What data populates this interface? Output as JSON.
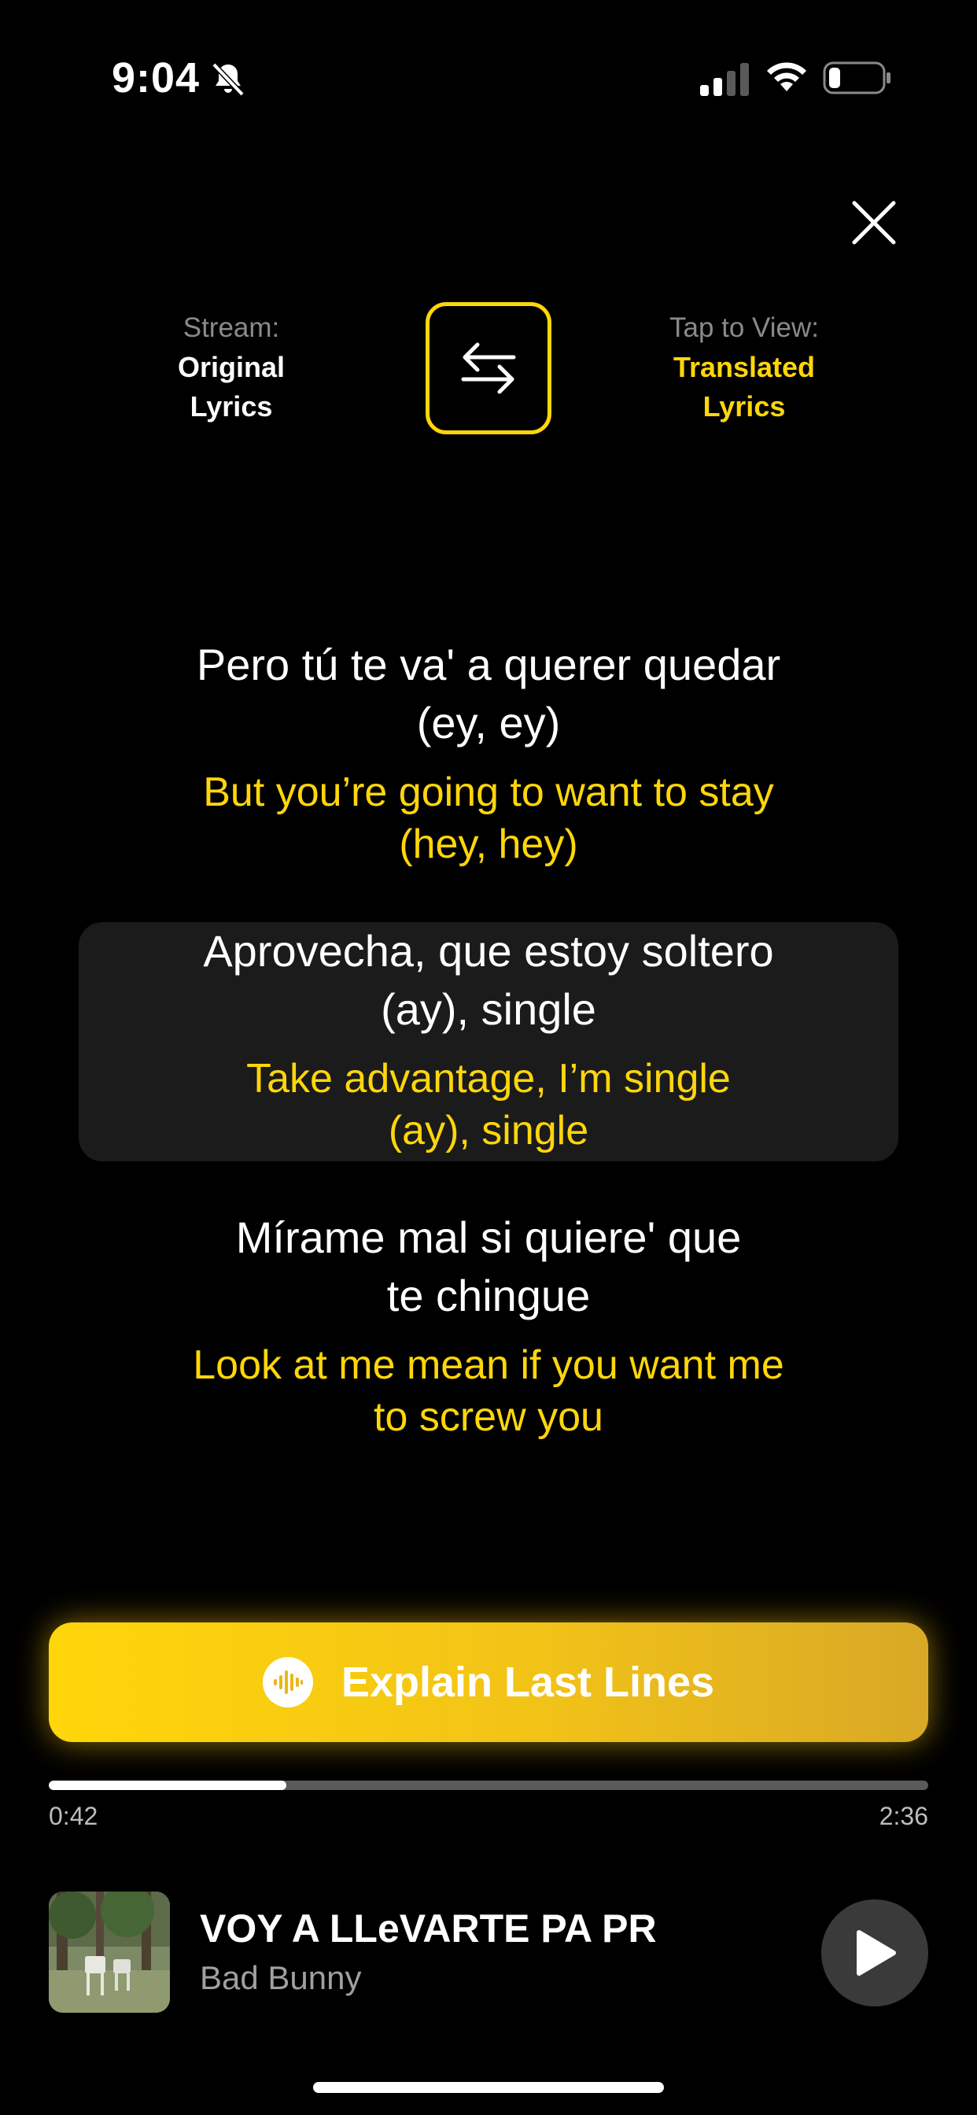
{
  "status_bar": {
    "time": "9:04"
  },
  "toggle": {
    "left_caption": "Stream:",
    "left_line1": "Original",
    "left_line2": "Lyrics",
    "right_caption": "Tap to View:",
    "right_line1": "Translated",
    "right_line2": "Lyrics"
  },
  "lyrics": [
    {
      "orig1": "Pero tú te va' a querer quedar",
      "orig2": "(ey, ey)",
      "trans1": "But you’re going to want to stay",
      "trans2": "(hey, hey)"
    },
    {
      "orig1": "Aprovecha, que estoy soltero",
      "orig2": "(ay), single",
      "trans1": "Take advantage, I’m single",
      "trans2": "(ay), single"
    },
    {
      "orig1": "Mírame mal si quiere' que",
      "orig2": "te chingue",
      "trans1": "Look at me mean if you want me",
      "trans2": "to screw you"
    }
  ],
  "explain_button": {
    "label": "Explain Last Lines"
  },
  "progress": {
    "elapsed": "0:42",
    "total": "2:36",
    "fraction": 0.27
  },
  "now_playing": {
    "title": "VOY A LLeVARTE PA PR",
    "artist": "Bad Bunny"
  },
  "colors": {
    "accent": "#ffd60a",
    "background": "#000000",
    "highlight_row": "#1b1b1b"
  }
}
